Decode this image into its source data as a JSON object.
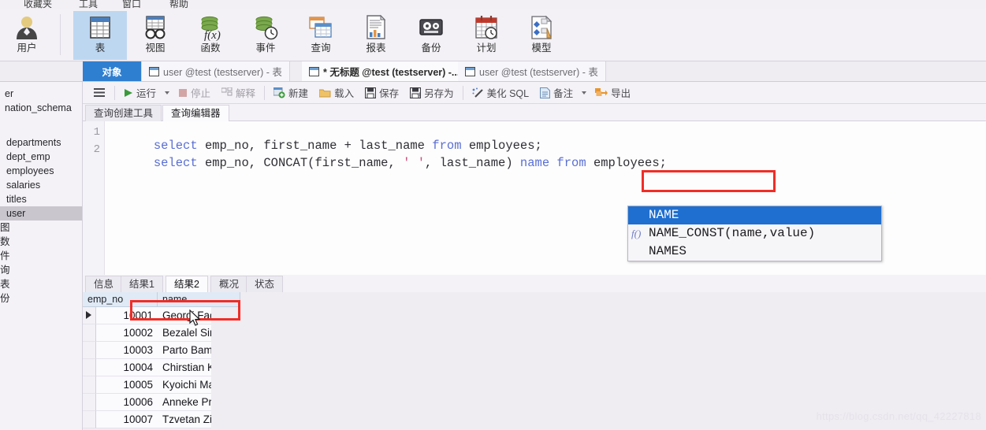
{
  "app": {
    "menu": [
      "收藏夹",
      "工具",
      "窗口",
      "帮助"
    ]
  },
  "ribbon": {
    "items": [
      {
        "label": "用户",
        "icon": "user-icon",
        "selected": false
      },
      {
        "label": "表",
        "icon": "table-icon",
        "selected": true
      },
      {
        "label": "视图",
        "icon": "view-glasses-icon",
        "selected": false
      },
      {
        "label": "函数",
        "icon": "function-fx-icon",
        "selected": false
      },
      {
        "label": "事件",
        "icon": "event-clock-icon",
        "selected": false
      },
      {
        "label": "查询",
        "icon": "query-icon",
        "selected": false
      },
      {
        "label": "报表",
        "icon": "report-icon",
        "selected": false
      },
      {
        "label": "备份",
        "icon": "backup-tape-icon",
        "selected": false
      },
      {
        "label": "计划",
        "icon": "schedule-calendar-icon",
        "selected": false
      },
      {
        "label": "模型",
        "icon": "model-diagram-icon",
        "selected": false
      }
    ]
  },
  "doc_tabs": {
    "object_label": "对象",
    "tabs": [
      {
        "label": "user @test (testserver) - 表",
        "icon": "table-pencil-icon",
        "active": false
      },
      {
        "label": "* 无标题 @test (testserver) -...",
        "icon": "query-window-icon",
        "active": true
      },
      {
        "label": "user @test (testserver) - 表",
        "icon": "grid-icon",
        "active": false
      }
    ]
  },
  "sidebar": {
    "items": [
      {
        "label": "er",
        "selected": false,
        "indent": 0
      },
      {
        "label": "nation_schema",
        "selected": false,
        "indent": 0
      },
      {
        "label": "departments",
        "selected": false,
        "indent": 6
      },
      {
        "label": "dept_emp",
        "selected": false,
        "indent": 6
      },
      {
        "label": "employees",
        "selected": false,
        "indent": 6
      },
      {
        "label": "salaries",
        "selected": false,
        "indent": 6
      },
      {
        "label": "titles",
        "selected": false,
        "indent": 6
      },
      {
        "label": "user",
        "selected": true,
        "indent": 6
      },
      {
        "label": "图",
        "selected": false,
        "indent": 0
      },
      {
        "label": "数",
        "selected": false,
        "indent": 0
      },
      {
        "label": "件",
        "selected": false,
        "indent": 0
      },
      {
        "label": "询",
        "selected": false,
        "indent": 0
      },
      {
        "label": "表",
        "selected": false,
        "indent": 0
      },
      {
        "label": "份",
        "selected": false,
        "indent": 0
      }
    ]
  },
  "query_toolbar": {
    "menu_icon": "hamburger-icon",
    "buttons": [
      {
        "label": "运行",
        "icon": "play-icon",
        "disabled": false,
        "has_caret": true
      },
      {
        "label": "停止",
        "icon": "stop-icon",
        "disabled": true,
        "has_caret": false
      },
      {
        "label": "解释",
        "icon": "explain-icon",
        "disabled": true,
        "has_caret": false
      },
      {
        "label": "新建",
        "icon": "new-icon",
        "disabled": false,
        "has_caret": false
      },
      {
        "label": "载入",
        "icon": "folder-open-icon",
        "disabled": false,
        "has_caret": false
      },
      {
        "label": "保存",
        "icon": "save-disk-icon",
        "disabled": false,
        "has_caret": false
      },
      {
        "label": "另存为",
        "icon": "save-as-icon",
        "disabled": false,
        "has_caret": false
      },
      {
        "label": "美化 SQL",
        "icon": "beautify-wand-icon",
        "disabled": false,
        "has_caret": false
      },
      {
        "label": "备注",
        "icon": "comment-doc-icon",
        "disabled": false,
        "has_caret": true
      },
      {
        "label": "导出",
        "icon": "export-arrow-icon",
        "disabled": false,
        "has_caret": false
      }
    ]
  },
  "query_tabs": [
    {
      "label": "查询创建工具",
      "active": false
    },
    {
      "label": "查询编辑器",
      "active": true
    }
  ],
  "editor": {
    "lines": [
      {
        "number": "1",
        "tokens": [
          {
            "t": "select ",
            "c": "k"
          },
          {
            "t": "emp_no, first_name + last_name ",
            "c": "p"
          },
          {
            "t": "from ",
            "c": "k"
          },
          {
            "t": "employees;",
            "c": "p"
          }
        ]
      },
      {
        "number": "2",
        "tokens": [
          {
            "t": "select ",
            "c": "k"
          },
          {
            "t": "emp_no, CONCAT(first_name, ",
            "c": "p"
          },
          {
            "t": "' '",
            "c": "s"
          },
          {
            "t": ", last_name) ",
            "c": "p"
          },
          {
            "t": "name from ",
            "c": "k"
          },
          {
            "t": "employees;",
            "c": "p"
          }
        ]
      }
    ]
  },
  "autocomplete": {
    "items": [
      {
        "label": "NAME",
        "prefix": "",
        "selected": true
      },
      {
        "label": "NAME_CONST(name,value)",
        "prefix": "f()",
        "selected": false
      },
      {
        "label": "NAMES",
        "prefix": "",
        "selected": false
      }
    ]
  },
  "result_tabs": [
    {
      "label": "信息",
      "active": false
    },
    {
      "label": "结果1",
      "active": false
    },
    {
      "label": "结果2",
      "active": true
    },
    {
      "label": "概况",
      "active": false
    },
    {
      "label": "状态",
      "active": false
    }
  ],
  "result_grid": {
    "columns": [
      "emp_no",
      "name"
    ],
    "rows": [
      {
        "emp_no": "10001",
        "name": "Georgi Fac",
        "current": true
      },
      {
        "emp_no": "10002",
        "name": "Bezalel Sir",
        "current": false
      },
      {
        "emp_no": "10003",
        "name": "Parto Bam",
        "current": false
      },
      {
        "emp_no": "10004",
        "name": "Chirstian K",
        "current": false
      },
      {
        "emp_no": "10005",
        "name": "Kyoichi Ma",
        "current": false
      },
      {
        "emp_no": "10006",
        "name": "Anneke Pr",
        "current": false
      },
      {
        "emp_no": "10007",
        "name": "Tzvetan Zi",
        "current": false
      }
    ]
  },
  "watermark": "https://blog.csdn.net/qq_42227818",
  "colors": {
    "accent": "#2f7fd1",
    "annotation": "#f02d27",
    "selection": "#1f6fd0",
    "keyword": "#5a6fd4",
    "string": "#c94c7c"
  }
}
